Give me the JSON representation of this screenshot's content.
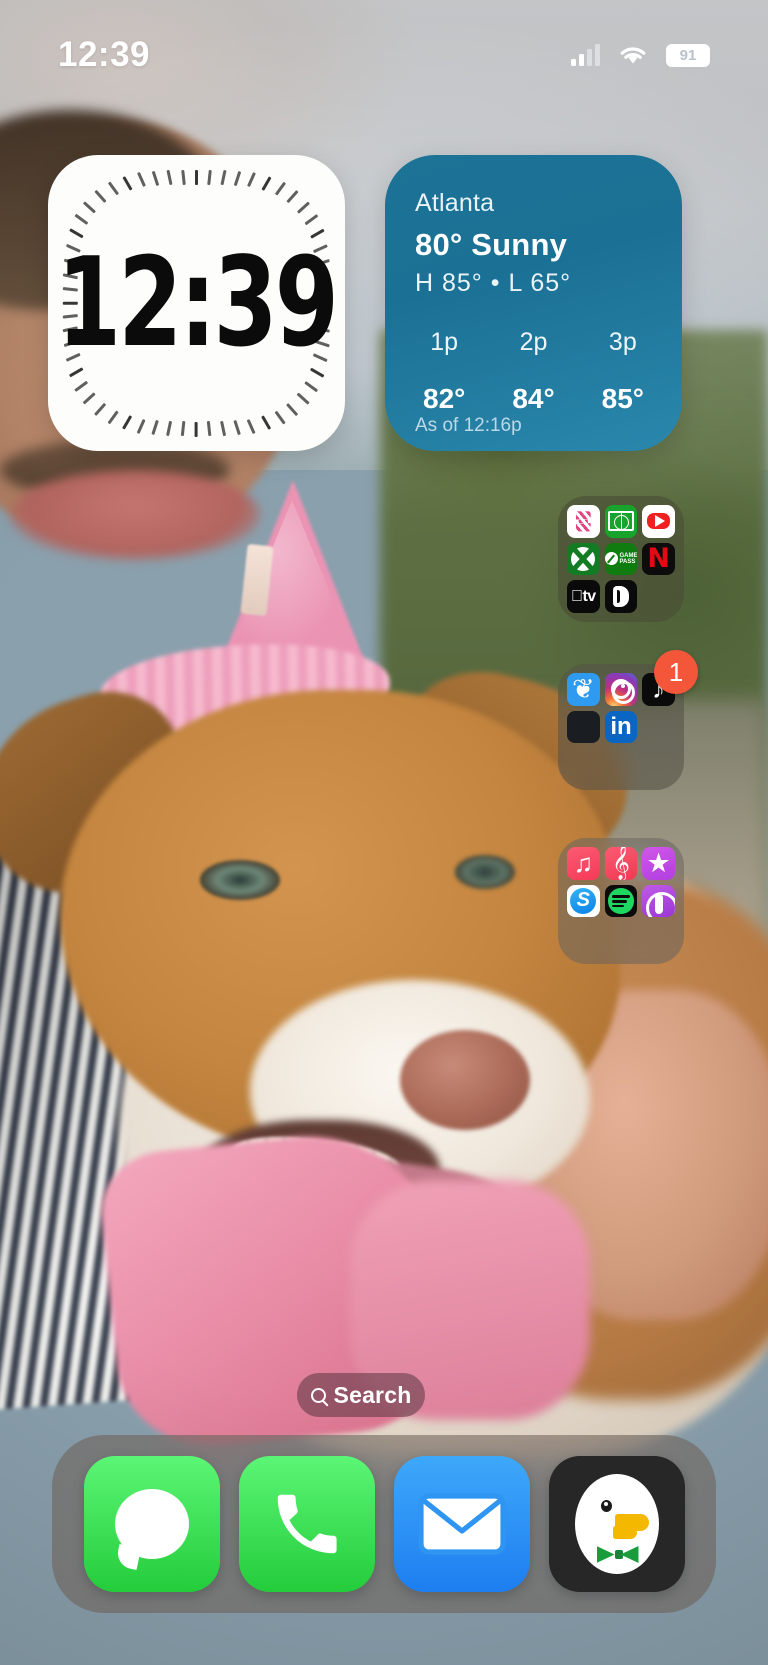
{
  "status_bar": {
    "time": "12:39",
    "battery_level": "91",
    "cellular_icon": "cellular-signal-icon",
    "wifi_icon": "wifi-icon",
    "battery_icon": "battery-icon"
  },
  "widgets": {
    "clock": {
      "name": "Clock",
      "time": "12:39"
    },
    "weather": {
      "city": "Atlanta",
      "current": "80° Sunny",
      "high_low": "H 85° • L 65°",
      "hourly": [
        {
          "hour": "1p",
          "temp": "82°"
        },
        {
          "hour": "2p",
          "temp": "84°"
        },
        {
          "hour": "3p",
          "temp": "85°"
        }
      ],
      "as_of": "As of 12:16p",
      "accent": "#1c7396"
    }
  },
  "folders": [
    {
      "name": "entertainment-folder",
      "badge": null,
      "apps": [
        {
          "name": "DIRECTV",
          "icon": "directv-icon"
        },
        {
          "name": "Soccer Field",
          "icon": "soccer-field-icon"
        },
        {
          "name": "YouTube",
          "icon": "youtube-icon"
        },
        {
          "name": "Xbox",
          "icon": "xbox-icon"
        },
        {
          "name": "Xbox Game Pass",
          "icon": "xbox-game-pass-icon",
          "label": "GAME PASS"
        },
        {
          "name": "Netflix",
          "icon": "netflix-icon",
          "glyph": "N"
        },
        {
          "name": "Apple TV",
          "icon": "apple-tv-icon",
          "glyph": "tv"
        },
        {
          "name": "DAZN",
          "icon": "dazn-icon"
        }
      ]
    },
    {
      "name": "social-folder",
      "badge": "1",
      "badge_color": "#f4563a",
      "apps": [
        {
          "name": "Bluesky",
          "icon": "bluesky-icon",
          "glyph": "❦"
        },
        {
          "name": "Instagram",
          "icon": "instagram-icon"
        },
        {
          "name": "TikTok",
          "icon": "tiktok-icon",
          "glyph": "♪"
        },
        {
          "name": "Slack",
          "icon": "slack-icon"
        },
        {
          "name": "LinkedIn",
          "icon": "linkedin-icon",
          "glyph": "in"
        }
      ]
    },
    {
      "name": "music-folder",
      "badge": null,
      "apps": [
        {
          "name": "Music",
          "icon": "apple-music-icon",
          "glyph": "♫"
        },
        {
          "name": "GarageBand",
          "icon": "garageband-icon",
          "glyph": "𝄞"
        },
        {
          "name": "Apple Music Classical",
          "icon": "apple-music-classical-icon",
          "glyph": "★"
        },
        {
          "name": "Shazam",
          "icon": "shazam-icon",
          "glyph": "S"
        },
        {
          "name": "Spotify",
          "icon": "spotify-icon"
        },
        {
          "name": "Podcasts",
          "icon": "apple-podcasts-icon"
        }
      ]
    }
  ],
  "search": {
    "label": "Search",
    "icon": "search-icon"
  },
  "dock": {
    "apps": [
      {
        "name": "Messages",
        "icon": "messages-icon"
      },
      {
        "name": "Phone",
        "icon": "phone-icon",
        "glyph": "✆"
      },
      {
        "name": "Mail",
        "icon": "mail-icon"
      },
      {
        "name": "DuckDuckGo",
        "icon": "duckduckgo-icon"
      }
    ]
  },
  "wallpaper": {
    "description": "Photo of a brown and white dog wearing a pink birthday party hat held by a person in a striped shirt"
  }
}
